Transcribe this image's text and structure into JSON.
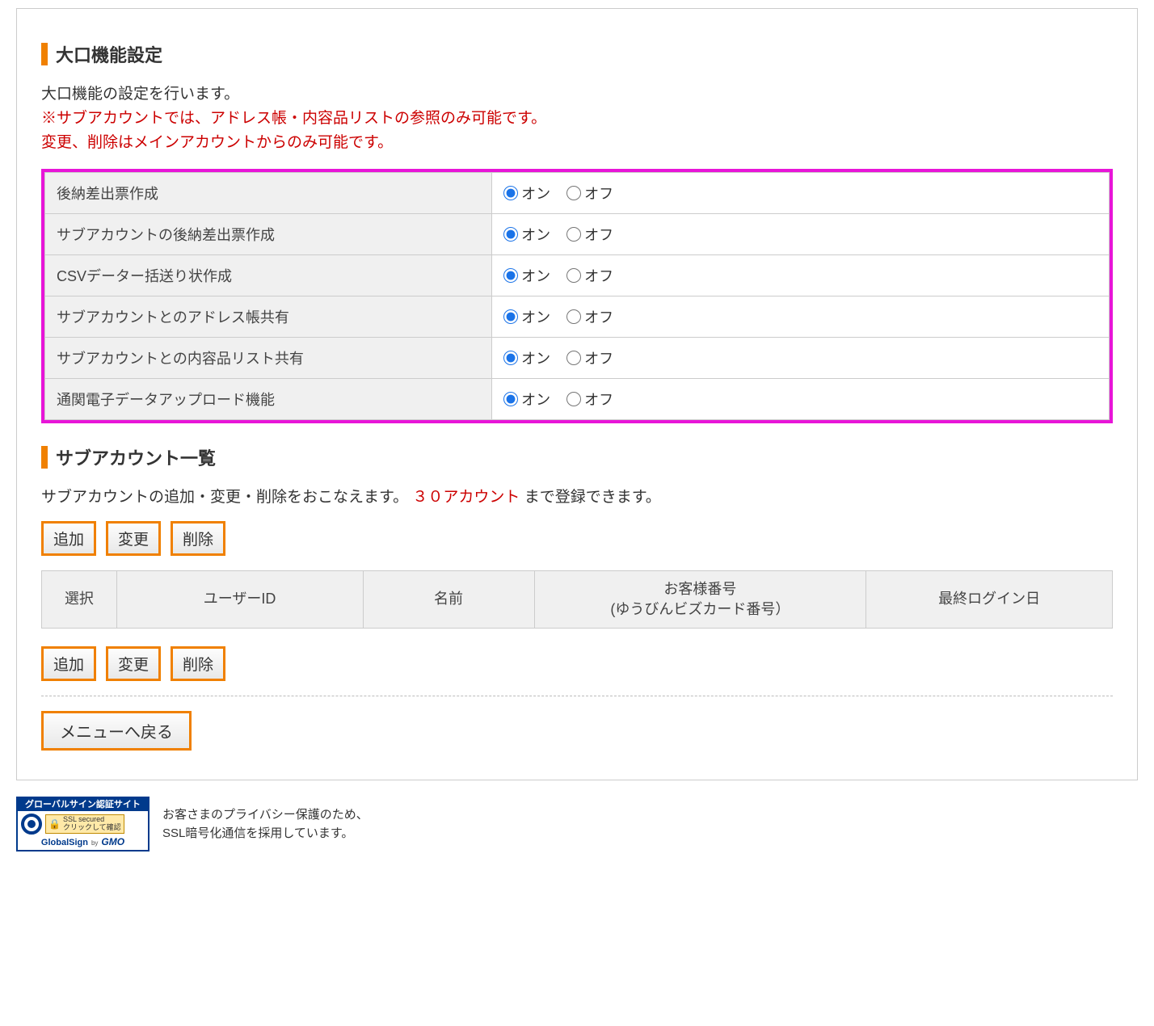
{
  "section1": {
    "title": "大口機能設定",
    "intro": "大口機能の設定を行います。",
    "note1": "※サブアカウントでは、アドレス帳・内容品リストの参照のみ可能です。",
    "note2": "変更、削除はメインアカウントからのみ可能です。"
  },
  "settings": {
    "onLabel": "オン",
    "offLabel": "オフ",
    "rows": [
      {
        "label": "後納差出票作成",
        "value": "on"
      },
      {
        "label": "サブアカウントの後納差出票作成",
        "value": "on"
      },
      {
        "label": "CSVデーター括送り状作成",
        "value": "on"
      },
      {
        "label": "サブアカウントとのアドレス帳共有",
        "value": "on"
      },
      {
        "label": "サブアカウントとの内容品リスト共有",
        "value": "on"
      },
      {
        "label": "通関電子データアップロード機能",
        "value": "on"
      }
    ]
  },
  "section2": {
    "title": "サブアカウント一覧",
    "intro_before": "サブアカウントの追加・変更・削除をおこなえます。",
    "intro_limit": "３０アカウント",
    "intro_after": "まで登録できます。"
  },
  "buttons": {
    "add": "追加",
    "edit": "変更",
    "delete": "削除",
    "back": "メニューへ戻る"
  },
  "table": {
    "col_select": "選択",
    "col_user": "ユーザーID",
    "col_name": "名前",
    "col_cust_line1": "お客様番号",
    "col_cust_line2": "(ゆうびんビズカード番号）",
    "col_login": "最終ログイン日"
  },
  "sslBadge": {
    "top": "グローバルサイン認証サイト",
    "secured": "SSL secured",
    "click": "クリックして確認",
    "gs": "GlobalSign",
    "by": "by",
    "gmo": "GMO"
  },
  "footer": {
    "line1": "お客さまのプライバシー保護のため、",
    "line2": "SSL暗号化通信を採用しています。"
  }
}
